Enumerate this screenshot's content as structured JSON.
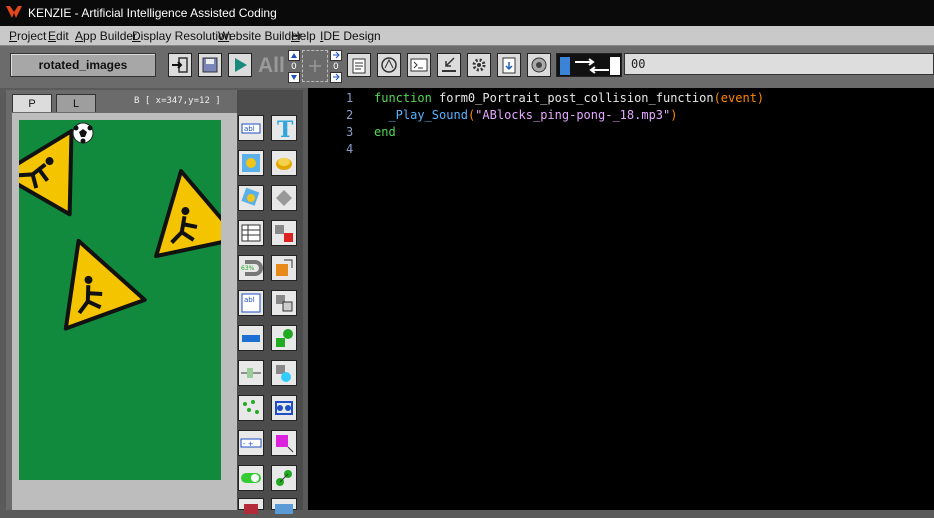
{
  "window": {
    "title": "KENZIE - Artificial Intelligence Assisted Coding"
  },
  "menu": [
    "Project",
    "Edit",
    "App Builder",
    "Display Resolution",
    "Website Builder",
    "Help",
    "IDE Design"
  ],
  "toolbar": {
    "project_name": "rotated_images",
    "all_label": "All",
    "command_value": "00",
    "stepper_values": [
      "0",
      "0"
    ]
  },
  "left_panel": {
    "tabs": [
      "P",
      "L"
    ],
    "coords": "B [ x=347,y=12 ]"
  },
  "editor": {
    "lines": [
      {
        "num": "1",
        "kw": "function",
        "name": " form0_Portrait_post_collision_function",
        "paren_open": "(",
        "arg": "event",
        "paren_close": ")"
      },
      {
        "num": "2",
        "indent": "  ",
        "call": "_Play_Sound",
        "paren_open": "(",
        "str": "\"ABlocks_ping-pong-_18.mp3\"",
        "paren_close": ")"
      },
      {
        "num": "3",
        "kw": "end"
      },
      {
        "num": "4"
      }
    ]
  },
  "colors": {
    "canvas_bg": "#118a3d",
    "editor_bg": "#000000",
    "keyword": "#53d953",
    "string": "#e6a8ff",
    "function": "#56b3ff"
  }
}
